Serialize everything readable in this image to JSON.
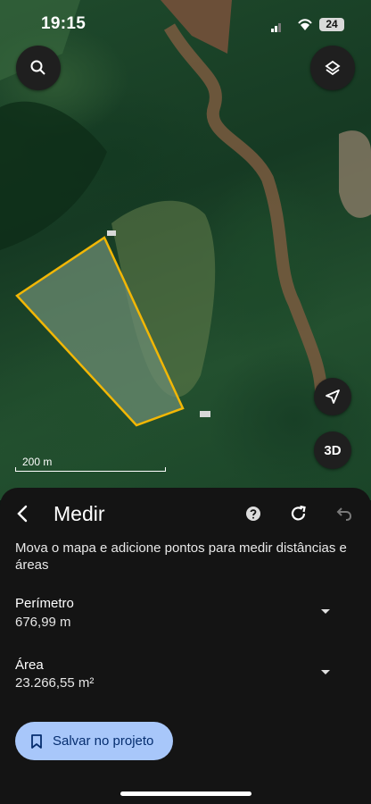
{
  "status_bar": {
    "time": "19:15",
    "battery": "24"
  },
  "map": {
    "scale_label": "200 m",
    "button_3d": "3D"
  },
  "panel": {
    "title": "Medir",
    "description": "Mova o mapa e adicione pontos para medir distâncias e áreas",
    "perimeter": {
      "label": "Perímetro",
      "value": "676,99 m"
    },
    "area": {
      "label": "Área",
      "value": "23.266,55 m²"
    },
    "save_label": "Salvar no projeto"
  },
  "colors": {
    "polygon_stroke": "#f2b705",
    "save_button": "#a8c7fa",
    "panel_bg": "#141414"
  },
  "icons": [
    "search-icon",
    "layers-icon",
    "navigation-icon",
    "back-arrow-icon",
    "help-icon",
    "redo-icon",
    "undo-icon",
    "dropdown-icon",
    "bookmark-icon"
  ]
}
